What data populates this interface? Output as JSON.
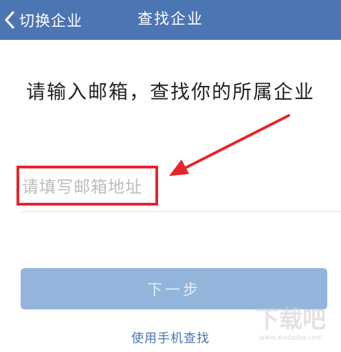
{
  "navbar": {
    "back_label": "切换企业",
    "title": "查找企业",
    "background": "#4c75b3",
    "back_icon": "chevron-left-icon"
  },
  "main": {
    "heading": "请输入邮箱，查找你的所属企业",
    "email_input": {
      "value": "",
      "placeholder": "请填写邮箱地址"
    },
    "next_button_label": "下一步",
    "phone_link_label": "使用手机查找"
  },
  "annotation": {
    "color": "#e8232a"
  },
  "watermark": {
    "main": "下载吧",
    "url": "www.xiazaiba.com"
  }
}
